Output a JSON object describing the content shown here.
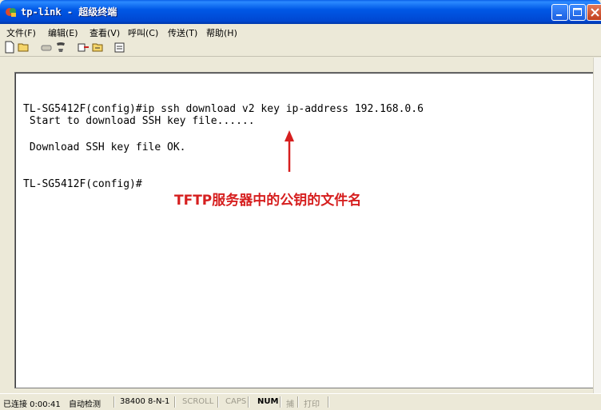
{
  "window": {
    "title": "tp-link - 超级终端"
  },
  "menu": [
    "文件(F)",
    "编辑(E)",
    "查看(V)",
    "呼叫(C)",
    "传送(T)",
    "帮助(H)"
  ],
  "toolbar_icons": [
    "new-icon",
    "open-icon",
    "disconnect-icon",
    "call-icon",
    "send-icon",
    "receive-icon",
    "properties-icon"
  ],
  "terminal": {
    "lines": [
      "TL-SG5412F(config)#ip ssh download v2 key ip-address 192.168.0.6",
      " Start to download SSH key file......",
      " Download SSH key file OK.",
      "TL-SG5412F(config)#"
    ]
  },
  "annotation": {
    "text": "TFTP服务器中的公钥的文件名",
    "color": "#d61f1f"
  },
  "status": {
    "connected": "已连接 0:00:41",
    "detect": "自动检测",
    "settings": "38400 8-N-1",
    "scroll": "SCROLL",
    "caps": "CAPS",
    "num": "NUM",
    "capture": "捕",
    "print": "打印"
  }
}
